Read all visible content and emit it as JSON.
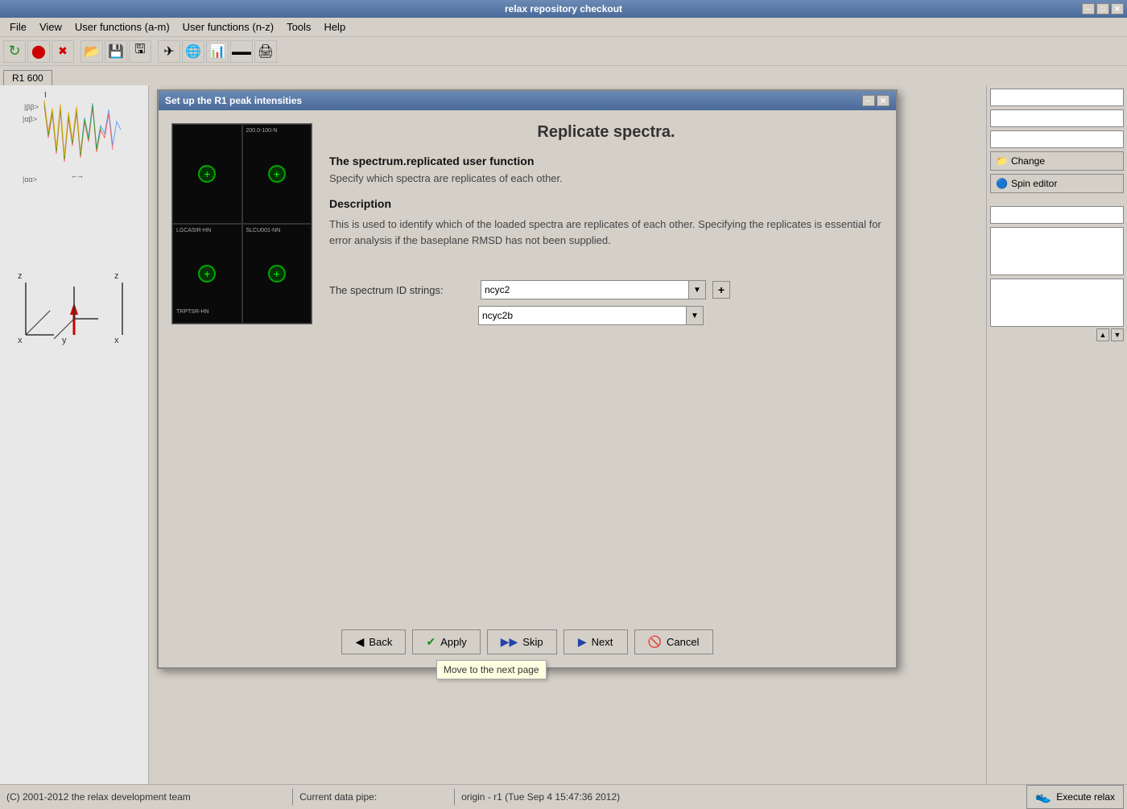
{
  "app": {
    "title": "relax repository checkout",
    "tab_label": "R1 600"
  },
  "menu": {
    "items": [
      "File",
      "View",
      "User functions (a-m)",
      "User functions (n-z)",
      "Tools",
      "Help"
    ]
  },
  "toolbar": {
    "buttons": [
      {
        "name": "new",
        "icon": "🔄"
      },
      {
        "name": "stop-red",
        "icon": "⬤"
      },
      {
        "name": "close-x",
        "icon": "✖"
      },
      {
        "name": "open",
        "icon": "📂"
      },
      {
        "name": "save",
        "icon": "💾"
      },
      {
        "name": "save-as",
        "icon": "🖫"
      },
      {
        "name": "run",
        "icon": "🚀"
      },
      {
        "name": "globe",
        "icon": "🌐"
      },
      {
        "name": "chart",
        "icon": "📊"
      },
      {
        "name": "bar",
        "icon": "▬"
      },
      {
        "name": "print",
        "icon": "🖨"
      }
    ]
  },
  "sidebar": {
    "inputs": [
      "",
      "",
      "",
      ""
    ],
    "change_btn": "Change",
    "spin_editor_btn": "Spin editor",
    "textarea1_placeholder": "",
    "textarea2_placeholder": ""
  },
  "dialog": {
    "title": "Set up the R1 peak intensities",
    "main_title": "Replicate spectra.",
    "function_section": {
      "title": "The spectrum.replicated user function",
      "subtitle": "Specify which spectra are replicates of each other."
    },
    "description_section": {
      "title": "Description",
      "text": "This is used to identify which of the loaded spectra are replicates of each other.  Specifying the replicates is essential for error analysis if the baseplane RMSD has not been supplied."
    },
    "form": {
      "label": "The spectrum ID strings:",
      "value1": "ncyc2",
      "value2": "ncyc2b"
    },
    "buttons": {
      "back": "Back",
      "apply": "Apply",
      "skip": "Skip",
      "next": "Next",
      "cancel": "Cancel"
    },
    "tooltip": "Move to the next page"
  },
  "status_bar": {
    "left": "(C) 2001-2012 the relax development team",
    "middle": "Current data pipe:",
    "right": "origin - r1 (Tue Sep  4 15:47:36 2012)",
    "execute_btn": "Execute relax"
  }
}
